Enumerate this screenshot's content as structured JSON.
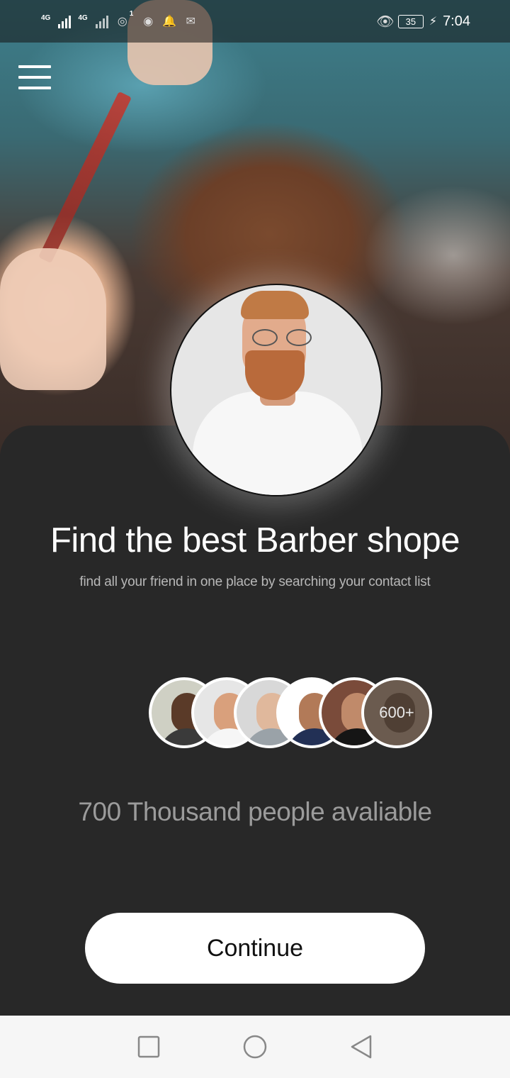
{
  "status_bar": {
    "network_1": "4G",
    "network_2": "4G",
    "notification_count": "1",
    "battery": "35",
    "time": "7:04"
  },
  "main": {
    "title": "Find the best Barber shope",
    "subtitle": "find all your friend in one place by searching your contact list",
    "avatars_more_label": "600+",
    "available_text": "700 Thousand people avaliable",
    "continue_label": "Continue"
  },
  "icons": {
    "menu": "hamburger-menu-icon",
    "nav_recent": "square-icon",
    "nav_home": "circle-icon",
    "nav_back": "triangle-back-icon"
  }
}
